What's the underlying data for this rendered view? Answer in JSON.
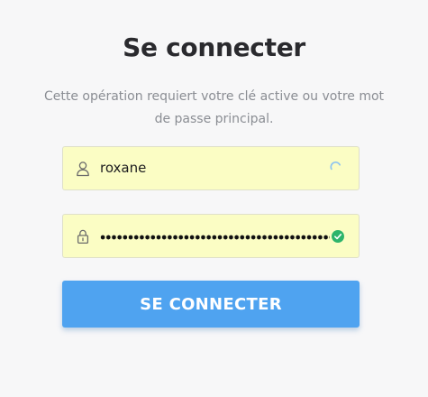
{
  "login": {
    "title": "Se connecter",
    "subtitle": "Cette opération requiert votre clé active ou votre mot de passe principal.",
    "username_value": "roxane",
    "password_masked": true,
    "submit_label": "SE CONNECTER"
  },
  "icons": {
    "username": "user-icon",
    "password": "lock-icon",
    "username_status": "loading-spinner-icon",
    "password_status": "check-circle-icon"
  },
  "colors": {
    "field_background": "#fbfdc4",
    "submit_button": "#4fa3f0",
    "valid_check": "#2db46b",
    "spinner": "#4fa3f0"
  }
}
